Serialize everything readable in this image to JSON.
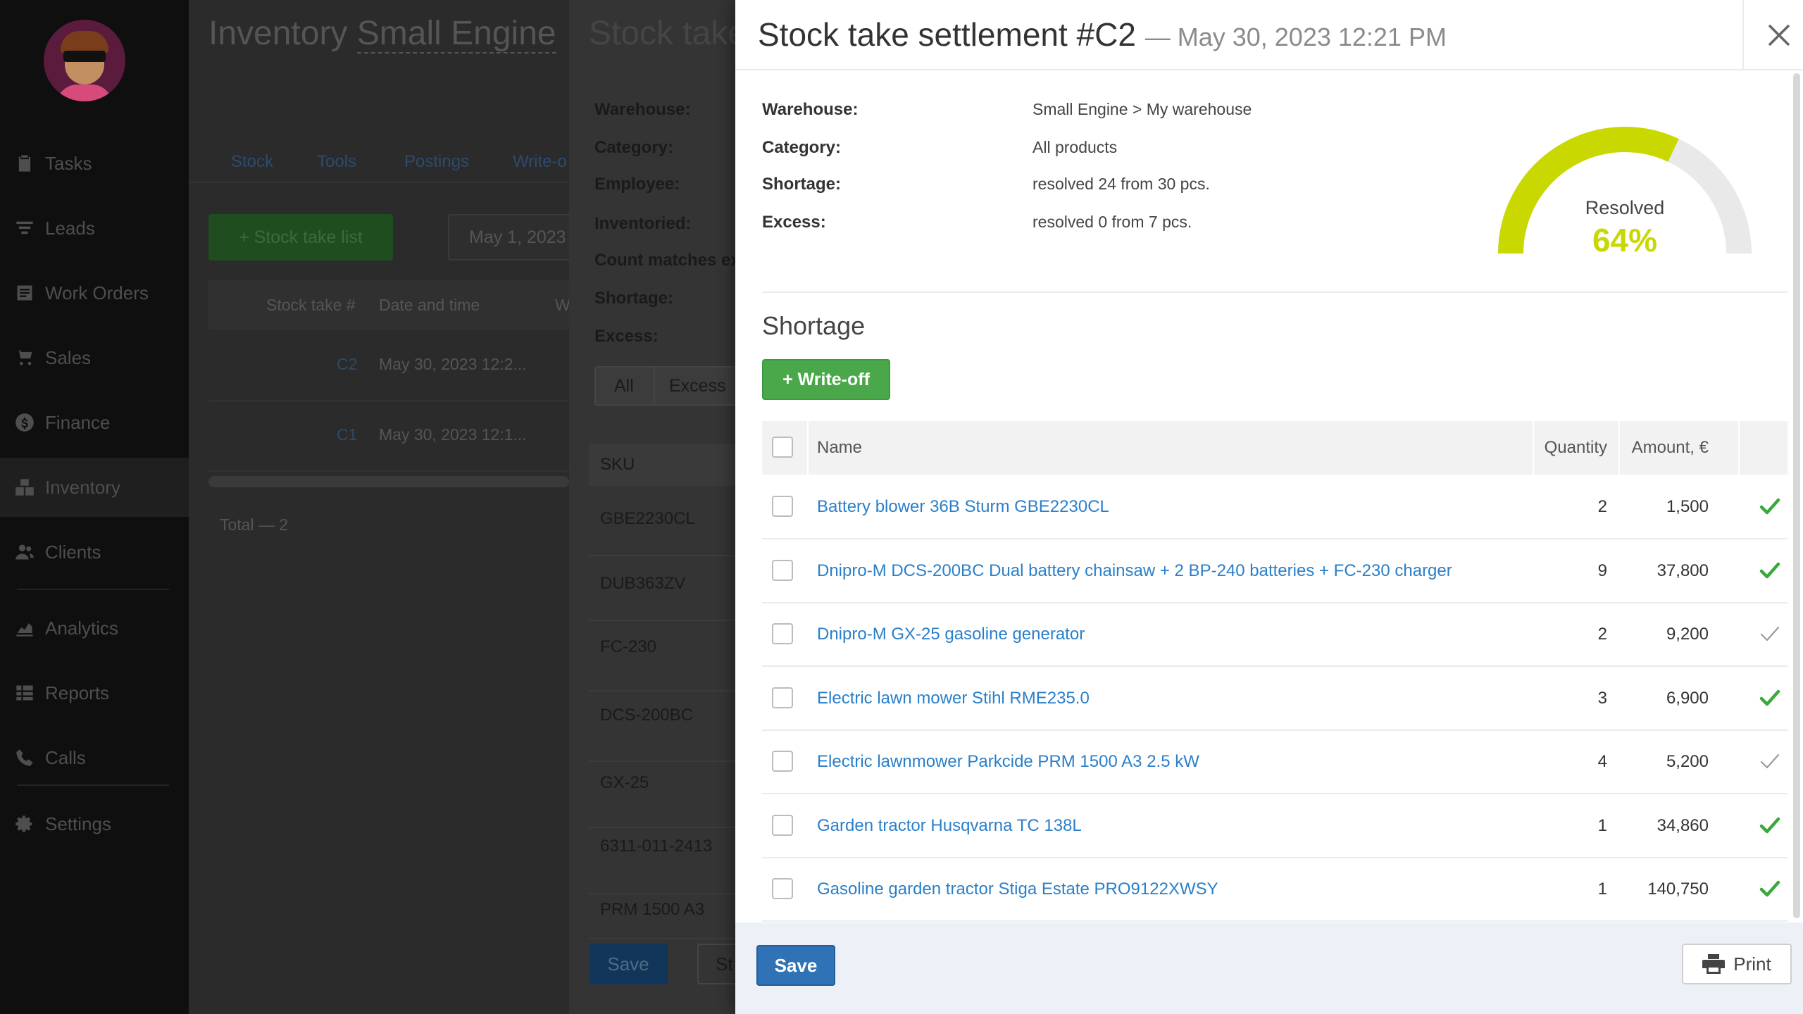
{
  "sidebar": {
    "items": [
      {
        "label": "Tasks",
        "icon": "clipboard-icon"
      },
      {
        "label": "Leads",
        "icon": "filter-icon"
      },
      {
        "label": "Work Orders",
        "icon": "work-order-icon"
      },
      {
        "label": "Sales",
        "icon": "cart-icon"
      },
      {
        "label": "Finance",
        "icon": "dollar-icon"
      },
      {
        "label": "Inventory",
        "icon": "boxes-icon",
        "active": true
      },
      {
        "label": "Clients",
        "icon": "users-icon"
      },
      {
        "label": "Analytics",
        "icon": "chart-icon"
      },
      {
        "label": "Reports",
        "icon": "reports-icon"
      },
      {
        "label": "Calls",
        "icon": "phone-icon"
      },
      {
        "label": "Settings",
        "icon": "gear-icon"
      }
    ]
  },
  "background_app": {
    "title_prefix": "Inventory",
    "title_company": "Small Engine",
    "tabs": [
      "Stock",
      "Tools",
      "Postings",
      "Write-o"
    ],
    "stock_take_list_button": "+ Stock take list",
    "date_filter": "May 1, 2023 -",
    "table_headers": [
      "Stock take #",
      "Date and time",
      "W"
    ],
    "rows": [
      {
        "number": "C2",
        "datetime": "May 30, 2023 12:2..."
      },
      {
        "number": "C1",
        "datetime": "May 30, 2023 12:1..."
      }
    ],
    "total": "Total — 2"
  },
  "middle_panel": {
    "title": "Stock take",
    "labels": [
      "Warehouse:",
      "Category:",
      "Employee:",
      "Inventoried:",
      "Count matches ex",
      "Shortage:",
      "Excess:"
    ],
    "filter_all": "All",
    "filter_excess": "Excess",
    "sku_header": "SKU",
    "skus": [
      "GBE2230CL",
      "DUB363ZV",
      "FC-230",
      "DCS-200BC",
      "GX-25",
      "6311-011-2413",
      "PRM 1500 A3"
    ],
    "save_button": "Save",
    "second_button": "St"
  },
  "modal": {
    "title": "Stock take settlement #C2",
    "subtitle": "— May 30, 2023 12:21 PM",
    "info": {
      "warehouse_label": "Warehouse:",
      "warehouse_value": "Small Engine > My warehouse",
      "category_label": "Category:",
      "category_value": "All products",
      "shortage_label": "Shortage:",
      "shortage_value": "resolved 24 from 30 pcs.",
      "excess_label": "Excess:",
      "excess_value": "resolved 0 from 7 pcs."
    },
    "gauge": {
      "label": "Resolved",
      "value_text": "64%",
      "value": 0.64,
      "fill_color": "#c9d800",
      "track_color": "#e9e9e9"
    },
    "section_title": "Shortage",
    "write_off_button": "+ Write-off",
    "table": {
      "headers": {
        "name": "Name",
        "quantity": "Quantity",
        "amount": "Amount, €"
      },
      "rows": [
        {
          "name": "Battery blower 36B Sturm GBE2230CL",
          "quantity": "2",
          "amount": "1,500",
          "resolved": true
        },
        {
          "name": "Dnipro-M DCS-200BC Dual battery chainsaw + 2 BP-240 batteries + FC-230 charger",
          "quantity": "9",
          "amount": "37,800",
          "resolved": true
        },
        {
          "name": "Dnipro-M GX-25 gasoline generator",
          "quantity": "2",
          "amount": "9,200",
          "resolved": false
        },
        {
          "name": "Electric lawn mower Stihl RME235.0",
          "quantity": "3",
          "amount": "6,900",
          "resolved": true
        },
        {
          "name": "Electric lawnmower Parkcide PRM 1500 A3 2.5 kW",
          "quantity": "4",
          "amount": "5,200",
          "resolved": false
        },
        {
          "name": "Garden tractor Husqvarna TC 138L",
          "quantity": "1",
          "amount": "34,860",
          "resolved": true
        },
        {
          "name": "Gasoline garden tractor Stiga Estate PRO9122XWSY",
          "quantity": "1",
          "amount": "140,750",
          "resolved": true
        }
      ]
    },
    "save_button": "Save",
    "print_button": "Print"
  },
  "colors": {
    "accent_green": "#4aa84a",
    "link_blue": "#2a7fc9",
    "save_blue": "#2f72b5",
    "gauge_yellow": "#c9d800",
    "check_green": "#3aa83a",
    "check_grey": "#9a9a9a"
  }
}
